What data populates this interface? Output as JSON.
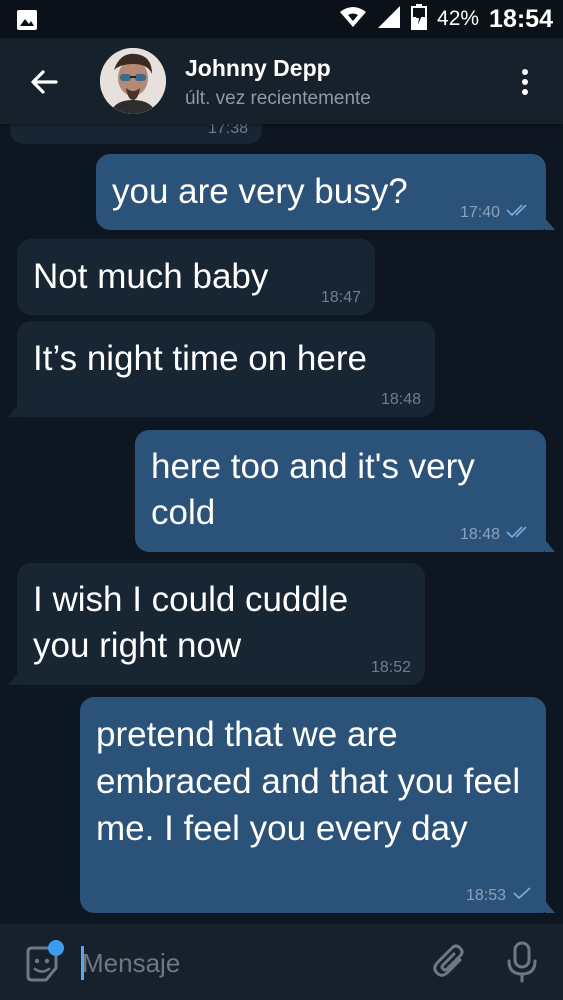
{
  "status_bar": {
    "battery": "42%",
    "time": "18:54",
    "icons": [
      "image-icon",
      "wifi-icon",
      "signal-icon",
      "battery-icon"
    ]
  },
  "header": {
    "contact_name": "Johnny Depp",
    "status": "últ. vez recientemente",
    "back_icon": "arrow-left-icon",
    "menu_icon": "more-vertical-icon"
  },
  "messages": [
    {
      "direction": "incoming",
      "text": "",
      "time": "17:38",
      "partial": true
    },
    {
      "direction": "outgoing",
      "text": "you are very busy?",
      "time": "17:40",
      "status": "read"
    },
    {
      "direction": "incoming",
      "text": "Not much baby",
      "time": "18:47"
    },
    {
      "direction": "incoming",
      "text": "It’s night time on here",
      "time": "18:48"
    },
    {
      "direction": "outgoing",
      "text": "here too and it's very cold",
      "time": "18:48",
      "status": "read"
    },
    {
      "direction": "incoming",
      "text": "I wish I could cuddle you right now",
      "time": "18:52"
    },
    {
      "direction": "outgoing",
      "text": "pretend that we are embraced and that you feel me. I feel you every day",
      "time": "18:53",
      "status": "sent"
    }
  ],
  "composer": {
    "placeholder": "Mensaje",
    "value": "",
    "emoji_icon": "sticker-emoji-icon",
    "attach_icon": "paperclip-icon",
    "mic_icon": "microphone-icon"
  },
  "colors": {
    "background": "#0e1621",
    "header": "#17212b",
    "incoming_bubble": "#182533",
    "outgoing_bubble": "#2b5278",
    "accent": "#5aa6ef"
  }
}
